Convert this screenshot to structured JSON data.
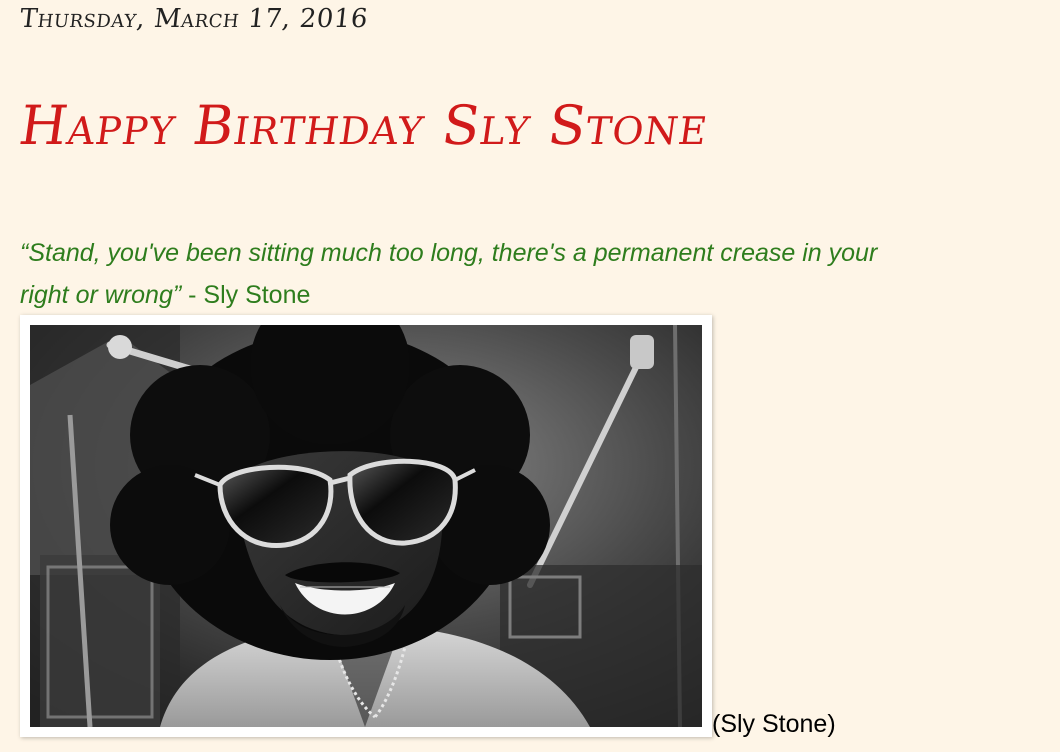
{
  "post": {
    "date": "Thursday, March 17, 2016",
    "title": "Happy Birthday Sly Stone",
    "quote_line1": "“Stand, you've been sitting much too long, there's a permanent crease in your",
    "quote_line2_italic": "right or wrong”",
    "quote_attribution": " - Sly Stone",
    "image_caption": "(Sly Stone)",
    "image_icon": "photo-sly-stone"
  },
  "colors": {
    "background": "#fef5e7",
    "title": "#d11a1a",
    "quote": "#2e7d1d",
    "date": "#222222"
  }
}
